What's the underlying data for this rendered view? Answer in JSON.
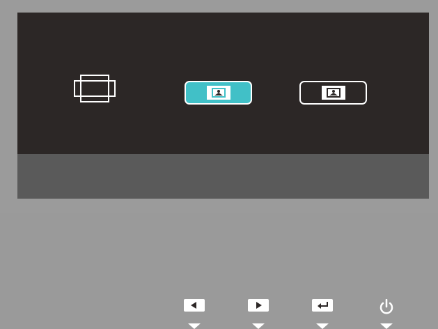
{
  "osd": {
    "title": "",
    "modes": [
      {
        "name": "original",
        "icon": "window-stack-icon",
        "selected": false
      },
      {
        "name": "fit",
        "icon": "picture-fit-icon",
        "selected": true
      },
      {
        "name": "full",
        "icon": "picture-full-icon",
        "selected": false
      }
    ],
    "keys": [
      {
        "name": "left",
        "icon": "left-arrow-icon"
      },
      {
        "name": "right",
        "icon": "right-arrow-icon"
      },
      {
        "name": "enter",
        "icon": "enter-icon"
      },
      {
        "name": "power",
        "icon": "power-icon"
      }
    ]
  },
  "colors": {
    "bezel": "#9b9b9b",
    "screen": "#2c2726",
    "keybar": "#5a5a5a",
    "accent": "#41c0c7",
    "foreground": "#ffffff"
  }
}
